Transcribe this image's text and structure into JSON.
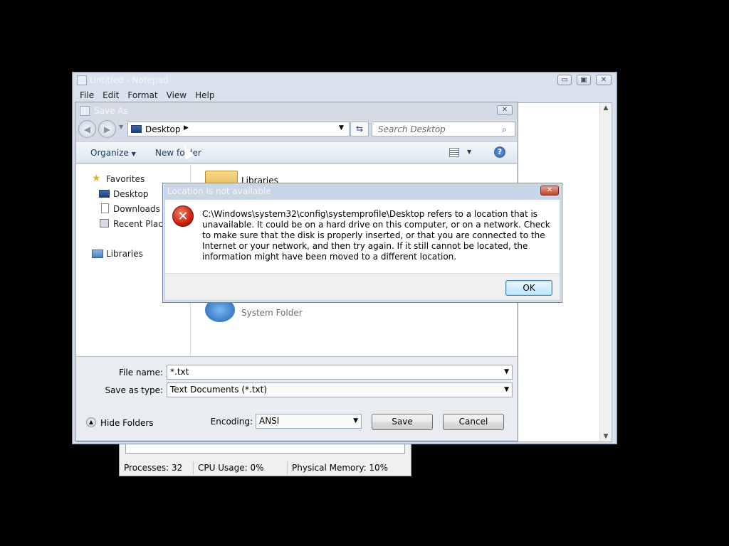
{
  "taskmgr": {
    "status": {
      "processes": "Processes: 32",
      "cpu": "CPU Usage: 0%",
      "memory": "Physical Memory: 10%"
    }
  },
  "notepad": {
    "title": "Untitled - Notepad",
    "menu": [
      "File",
      "Edit",
      "Format",
      "View",
      "Help"
    ],
    "caption_buttons": {
      "minimize": "▭",
      "maximize": "▣",
      "close": "✕"
    }
  },
  "saveas": {
    "title": "Save As",
    "address": "Desktop",
    "search_placeholder": "Search Desktop",
    "toolbar": {
      "organize": "Organize",
      "new_folder": "New folder",
      "help": "?"
    },
    "nav": {
      "favorites": "Favorites",
      "desktop": "Desktop",
      "downloads": "Downloads",
      "recent": "Recent Places",
      "libraries": "Libraries"
    },
    "content": {
      "libraries": "Libraries",
      "system_folder": "System Folder"
    },
    "filename_label": "File name:",
    "filename_value": "*.txt",
    "type_label": "Save as type:",
    "type_value": "Text Documents (*.txt)",
    "hide_folders": "Hide Folders",
    "encoding_label": "Encoding:",
    "encoding_value": "ANSI",
    "save_button": "Save",
    "cancel_button": "Cancel"
  },
  "error_dialog": {
    "title": "Location is not available",
    "message": "C:\\Windows\\system32\\config\\systemprofile\\Desktop refers to a location that is unavailable. It could be on a hard drive on this computer, or on a network. Check to make sure that the disk is properly inserted, or that you are connected to the Internet or your network, and then try again. If it still cannot be located, the information might have been moved to a different location.",
    "ok_button": "OK"
  },
  "colors": {
    "error_red": "#c8230f",
    "ok_blue": "#3c7fb1",
    "toolbar_text": "#1e395b"
  }
}
